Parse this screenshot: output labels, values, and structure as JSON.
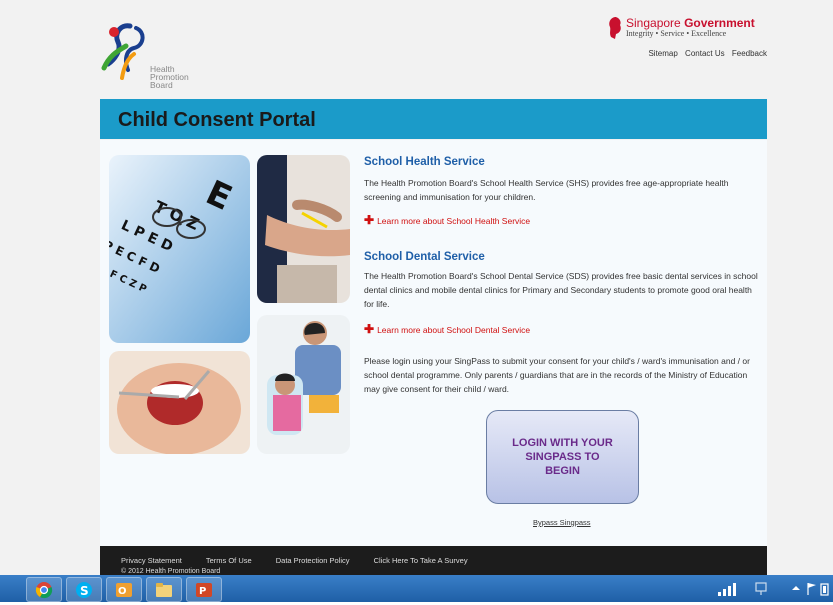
{
  "header": {
    "hpb_logo_lines": [
      "Health",
      "Promotion",
      "Board"
    ],
    "sg_gov_name_a": "Singapore",
    "sg_gov_name_b": "Government",
    "sg_gov_tagline": "Integrity • Service • Excellence",
    "links": [
      "Sitemap",
      "Contact Us",
      "Feedback"
    ]
  },
  "banner": {
    "title": "Child Consent Portal"
  },
  "shs": {
    "title": "School Health Service",
    "desc": "The Health Promotion Board's School Health Service (SHS) provides free age-appropriate health screening and immunisation for your children.",
    "learn": "Learn more about School Health Service"
  },
  "sds": {
    "title": "School Dental Service",
    "desc": "The Health Promotion Board's School Dental Service (SDS) provides free basic dental services in school dental clinics and mobile dental clinics for Primary and Secondary students to promote good oral health for life.",
    "learn": "Learn more about School Dental Service"
  },
  "login_text": "Please login using your SingPass to submit your consent for your child's / ward's immunisation and / or school dental programme. Only parents / guardians that are in the records of the Ministry of Education may give consent for their child / ward.",
  "login_button": "LOGIN WITH YOUR SINGPASS TO BEGIN",
  "bypass": "Bypass Singpass",
  "footer": {
    "links": [
      "Privacy Statement",
      "Terms Of Use",
      "Data Protection Policy",
      "Click Here To Take A Survey"
    ],
    "copyright": "© 2012 Health Promotion Board"
  },
  "taskbar": {
    "apps": [
      "chrome-icon",
      "skype-icon",
      "outlook-icon",
      "file-explorer-icon",
      "powerpoint-icon"
    ]
  },
  "colors": {
    "banner": "#1b9bc9",
    "section_title": "#1f5fa8",
    "learn_more": "#d01010",
    "footer": "#1c1c1c"
  }
}
